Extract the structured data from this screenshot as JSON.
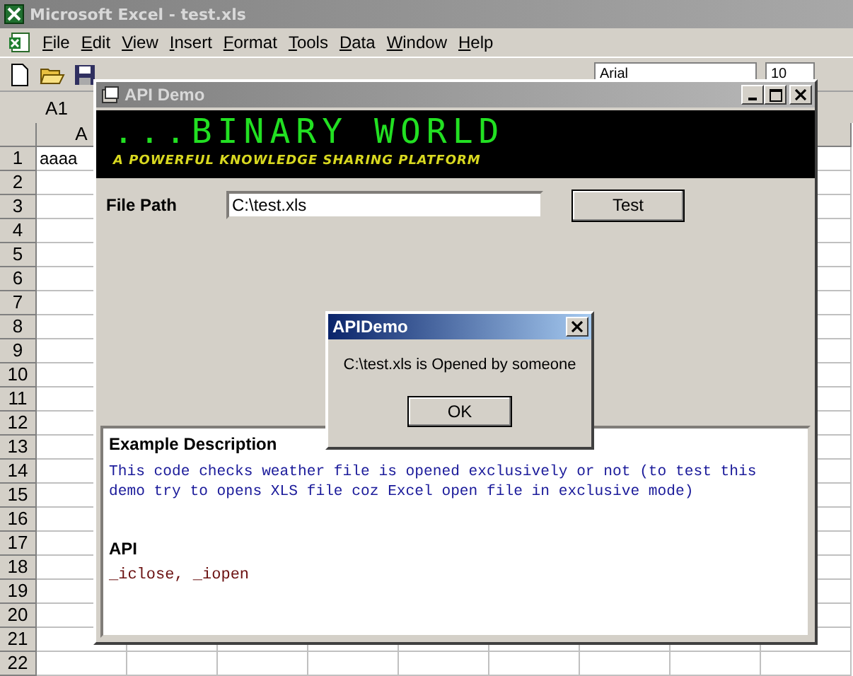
{
  "excel": {
    "title": "Microsoft Excel - test.xls",
    "menu": [
      "File",
      "Edit",
      "View",
      "Insert",
      "Format",
      "Tools",
      "Data",
      "Window",
      "Help"
    ],
    "font_name": "Arial",
    "font_size": "10",
    "name_box": "A1",
    "column_a": "A",
    "rows": [
      {
        "number": "1",
        "cell_a": "aaaa"
      },
      {
        "number": "2"
      },
      {
        "number": "3"
      },
      {
        "number": "4"
      },
      {
        "number": "5"
      },
      {
        "number": "6"
      },
      {
        "number": "7"
      },
      {
        "number": "8"
      },
      {
        "number": "9"
      },
      {
        "number": "10"
      },
      {
        "number": "11"
      },
      {
        "number": "12"
      },
      {
        "number": "13"
      },
      {
        "number": "14"
      },
      {
        "number": "15"
      },
      {
        "number": "16"
      },
      {
        "number": "17"
      },
      {
        "number": "18"
      },
      {
        "number": "19"
      },
      {
        "number": "20"
      },
      {
        "number": "21"
      },
      {
        "number": "22"
      }
    ]
  },
  "app_window": {
    "title": "API Demo",
    "banner": {
      "title": "...BINARY WORLD",
      "tagline": "A POWERFUL KNOWLEDGE SHARING PLATFORM"
    },
    "file_path_label": "File Path",
    "file_path": "C:\\test.xls",
    "test_button": "Test",
    "description_heading": "Example Description",
    "description": "This code checks weather file is opened exclusively or not (to test this demo try to opens XLS file coz Excel open file in exclusive mode)",
    "api_heading": "API",
    "api": "_iclose, _iopen"
  },
  "message_box": {
    "title": "APIDemo",
    "message": "C:\\test.xls is Opened by someone",
    "ok_button": "OK"
  }
}
